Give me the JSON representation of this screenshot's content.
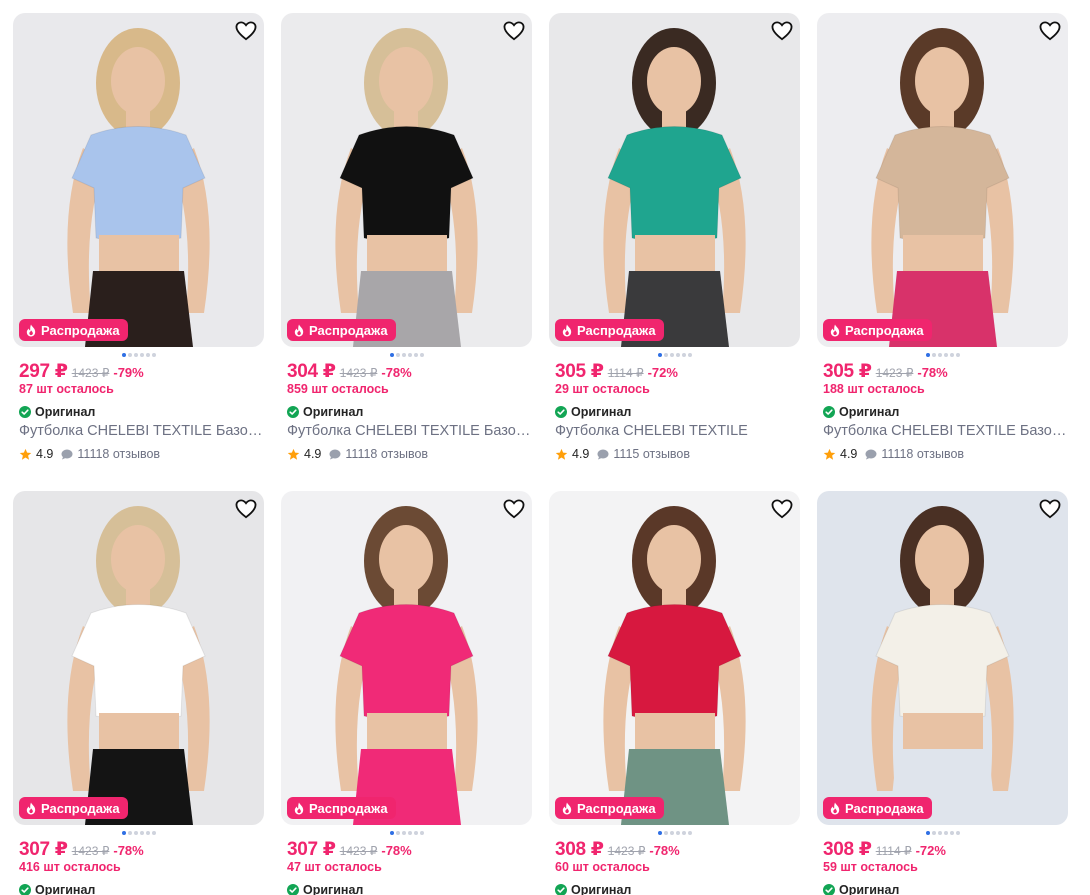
{
  "products": [
    {
      "price": "297 ₽",
      "old_price": "1423 ₽",
      "discount": "-79%",
      "stock": "87 шт осталось",
      "original": "Оригинал",
      "title": "Футболка CHELEBI TEXTILE Базовая",
      "rating": "4.9",
      "reviews": "11118 отзывов",
      "badge": "Распродажа",
      "shirt_color": "#a9c4ec",
      "bg_color": "#e9e9ec",
      "pants_color": "#2a1f1c",
      "hair_color": "#d8b98a"
    },
    {
      "price": "304 ₽",
      "old_price": "1423 ₽",
      "discount": "-78%",
      "stock": "859 шт осталось",
      "original": "Оригинал",
      "title": "Футболка CHELEBI TEXTILE Базовая",
      "rating": "4.9",
      "reviews": "11118 отзывов",
      "badge": "Распродажа",
      "shirt_color": "#111111",
      "bg_color": "#ebebed",
      "pants_color": "#a8a6a9",
      "hair_color": "#d6bf98"
    },
    {
      "price": "305 ₽",
      "old_price": "1114 ₽",
      "discount": "-72%",
      "stock": "29 шт осталось",
      "original": "Оригинал",
      "title": "Футболка CHELEBI TEXTILE",
      "rating": "4.9",
      "reviews": "1115 отзывов",
      "badge": "Распродажа",
      "shirt_color": "#1fa58f",
      "bg_color": "#e8e8ea",
      "pants_color": "#3a3a3c",
      "hair_color": "#3a2a22"
    },
    {
      "price": "305 ₽",
      "old_price": "1423 ₽",
      "discount": "-78%",
      "stock": "188 шт осталось",
      "original": "Оригинал",
      "title": "Футболка CHELEBI TEXTILE Базовая",
      "rating": "4.9",
      "reviews": "11118 отзывов",
      "badge": "Распродажа",
      "shirt_color": "#d4b69a",
      "bg_color": "#ededf0",
      "pants_color": "#d8326a",
      "hair_color": "#5a3a28"
    },
    {
      "price": "307 ₽",
      "old_price": "1423 ₽",
      "discount": "-78%",
      "stock": "416 шт осталось",
      "original": "Оригинал",
      "title": "",
      "rating": "",
      "reviews": "",
      "badge": "Распродажа",
      "shirt_color": "#ffffff",
      "bg_color": "#e6e6e8",
      "pants_color": "#141414",
      "hair_color": "#d6bf98"
    },
    {
      "price": "307 ₽",
      "old_price": "1423 ₽",
      "discount": "-78%",
      "stock": "47 шт осталось",
      "original": "Оригинал",
      "title": "",
      "rating": "",
      "reviews": "",
      "badge": "Распродажа",
      "shirt_color": "#f02a77",
      "bg_color": "#f1f1f3",
      "pants_color": "#f02a77",
      "hair_color": "#6b4a34"
    },
    {
      "price": "308 ₽",
      "old_price": "1423 ₽",
      "discount": "-78%",
      "stock": "60 шт осталось",
      "original": "Оригинал",
      "title": "",
      "rating": "",
      "reviews": "",
      "badge": "Распродажа",
      "shirt_color": "#d7183f",
      "bg_color": "#f3f3f4",
      "pants_color": "#6f9384",
      "hair_color": "#5a3828"
    },
    {
      "price": "308 ₽",
      "old_price": "1114 ₽",
      "discount": "-72%",
      "stock": "59 шт осталось",
      "original": "Оригинал",
      "title": "",
      "rating": "",
      "reviews": "",
      "badge": "Распродажа",
      "shirt_color": "#f3f0e8",
      "bg_color": "#dfe4ec",
      "pants_color": "#dfe4ec",
      "hair_color": "#4a3024"
    }
  ]
}
